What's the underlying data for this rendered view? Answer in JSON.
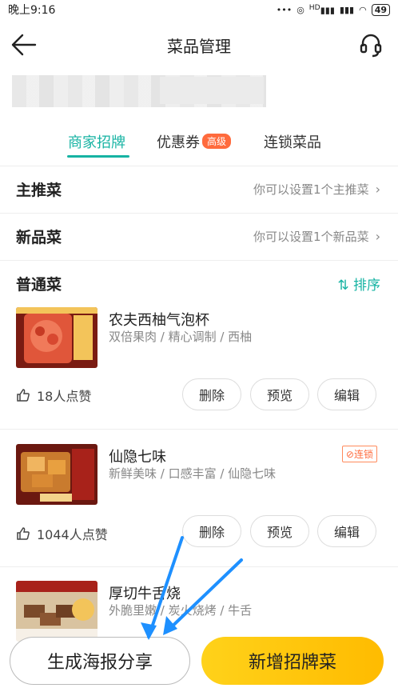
{
  "status_bar": {
    "time": "晚上9:16",
    "signal_text": "HD",
    "battery": "49"
  },
  "nav": {
    "title": "菜品管理"
  },
  "tabs": [
    {
      "label": "商家招牌"
    },
    {
      "label": "优惠券",
      "badge": "高级"
    },
    {
      "label": "连锁菜品"
    }
  ],
  "sections": {
    "main": {
      "title": "主推菜",
      "hint": "你可以设置1个主推菜"
    },
    "new": {
      "title": "新品菜",
      "hint": "你可以设置1个新品菜"
    },
    "normal": {
      "title": "普通菜",
      "sort_label": "排序",
      "sort_icon": "⇅"
    }
  },
  "dishes": [
    {
      "name": "农夫西柚气泡杯",
      "desc": "双倍果肉 / 精心调制 / 西柚",
      "likes": "18人点赞",
      "chain_tag": ""
    },
    {
      "name": "仙隐七味",
      "desc": "新鲜美味 / 口感丰富 / 仙隐七味",
      "likes": "1044人点赞",
      "chain_tag": "连锁"
    },
    {
      "name": "厚切牛舌烧",
      "desc": "外脆里嫩 / 炭火烧烤 / 牛舌",
      "likes": "",
      "chain_tag": ""
    }
  ],
  "actions": {
    "delete": "删除",
    "preview": "预览",
    "edit": "编辑"
  },
  "bottom": {
    "share": "生成海报分享",
    "add": "新增招牌菜"
  },
  "colors": {
    "accent": "#16b3a3",
    "badge": "#ff6b3d",
    "primary_button": "#ffc400",
    "annotation_arrow": "#1e90ff"
  },
  "icons": [
    "back-arrow-icon",
    "headset-icon",
    "thumb-up-icon",
    "chain-link-icon",
    "sort-icon",
    "chevron-right-icon"
  ]
}
